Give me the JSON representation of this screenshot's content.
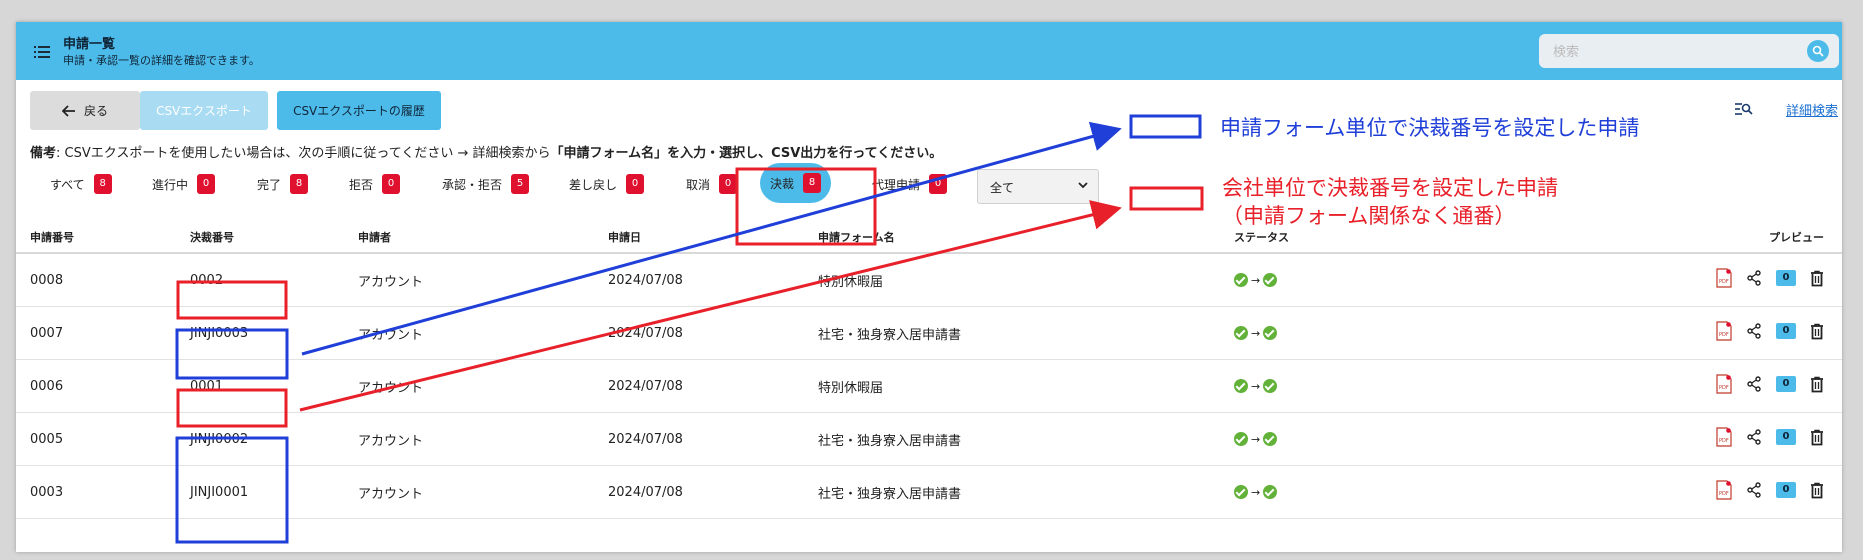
{
  "header": {
    "title": "申請一覧",
    "subtitle": "申請・承認一覧の詳細を確認できます。",
    "search_placeholder": "検索"
  },
  "toolbar": {
    "back_label": "戻る",
    "csv_export_label": "CSVエクスポート",
    "csv_history_label": "CSVエクスポートの履歴",
    "advanced_search_label": "詳細検索"
  },
  "note": {
    "prefix": "備考",
    "text1": ": CSVエクスポートを使用したい場合は、次の手順に従ってください → 詳細検索から",
    "strong": "「申請フォーム名」を入力・選択し、CSV出力を行ってください。"
  },
  "filters": [
    {
      "label": "すべて",
      "count": "8"
    },
    {
      "label": "進行中",
      "count": "0"
    },
    {
      "label": "完了",
      "count": "8"
    },
    {
      "label": "拒否",
      "count": "0"
    },
    {
      "label": "承認・拒否",
      "count": "5"
    },
    {
      "label": "差し戻し",
      "count": "0"
    },
    {
      "label": "取消",
      "count": "0"
    },
    {
      "label": "決裁",
      "count": "8"
    },
    {
      "label": "代理申請",
      "count": "0"
    }
  ],
  "select": {
    "value": "全て"
  },
  "table": {
    "columns": [
      "申請番号",
      "決裁番号",
      "申請者",
      "申請日",
      "申請フォーム名",
      "ステータス",
      "プレビュー"
    ],
    "rows": [
      {
        "id": "0008",
        "approval": "0002",
        "applicant": "アカウント",
        "date": "2024/07/08",
        "form": "特別休暇届",
        "comments": "0"
      },
      {
        "id": "0007",
        "approval": "JINJI0003",
        "applicant": "アカウント",
        "date": "2024/07/08",
        "form": "社宅・独身寮入居申請書",
        "comments": "0"
      },
      {
        "id": "0006",
        "approval": "0001",
        "applicant": "アカウント",
        "date": "2024/07/08",
        "form": "特別休暇届",
        "comments": "0"
      },
      {
        "id": "0005",
        "approval": "JINJI0002",
        "applicant": "アカウント",
        "date": "2024/07/08",
        "form": "社宅・独身寮入居申請書",
        "comments": "0"
      },
      {
        "id": "0003",
        "approval": "JINJI0001",
        "applicant": "アカウント",
        "date": "2024/07/08",
        "form": "社宅・独身寮入居申請書",
        "comments": "0"
      }
    ]
  },
  "annotations": {
    "blue_label": "申請フォーム単位で決裁番号を設定した申請",
    "red_label_line1": "会社単位で決裁番号を設定した申請",
    "red_label_line2": "（申請フォーム関係なく通番）",
    "blue_color": "#1f3fd8",
    "red_color": "#e8202a"
  },
  "colors": {
    "header_bg": "#4dbbea",
    "badge": "#e0102f",
    "status_ok": "#62b23a"
  }
}
